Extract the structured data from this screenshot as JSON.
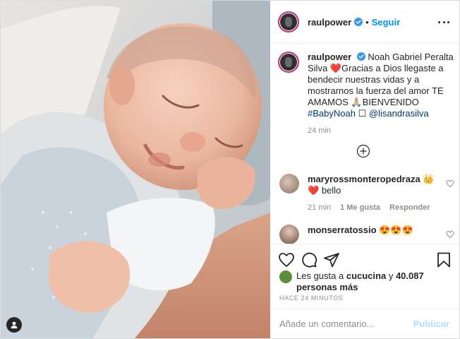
{
  "header": {
    "username": "raulpower",
    "separator": "•",
    "follow_label": "Seguir"
  },
  "caption": {
    "username": "raulpower",
    "text_1": "Noah Gabriel Peralta Silva",
    "heart_emoji": "❤️",
    "text_2": "Gracias a Dios llegaste a bendecir nuestras vidas y a mostrarnos la fuerza del amor TE AMAMOS",
    "pray_emoji": "🙏🏼",
    "text_3": "BIENVENIDO",
    "hashtag": "#BabyNoah",
    "box_glyph": "☐",
    "mention": "@lisandrasilva",
    "time": "24 min"
  },
  "comments": [
    {
      "username": "maryrossmonteropedraza",
      "emoji_1": "👑",
      "emoji_2": "❤️",
      "text": "bello",
      "time": "21 min",
      "likes": "1 Me gusta",
      "reply_label": "Responder"
    },
    {
      "username": "monserratossio",
      "text": "😍😍😍"
    }
  ],
  "likes": {
    "prefix": "Les gusta a",
    "user": "cucucina",
    "joiner": "y",
    "count": "40.087 personas más"
  },
  "timestamp": "HACE 24 MINUTOS",
  "composer": {
    "placeholder": "Añade un comentario...",
    "publish_label": "Publicar"
  },
  "colors": {
    "accent": "#0095f6",
    "link": "#00376b",
    "muted": "#8e8e8e",
    "publish_disabled": "#b2dffc"
  },
  "icons": [
    "verified-icon",
    "more-options-icon",
    "load-more-icon",
    "heart-icon",
    "comment-icon",
    "share-icon",
    "bookmark-icon",
    "user-tag-icon"
  ]
}
